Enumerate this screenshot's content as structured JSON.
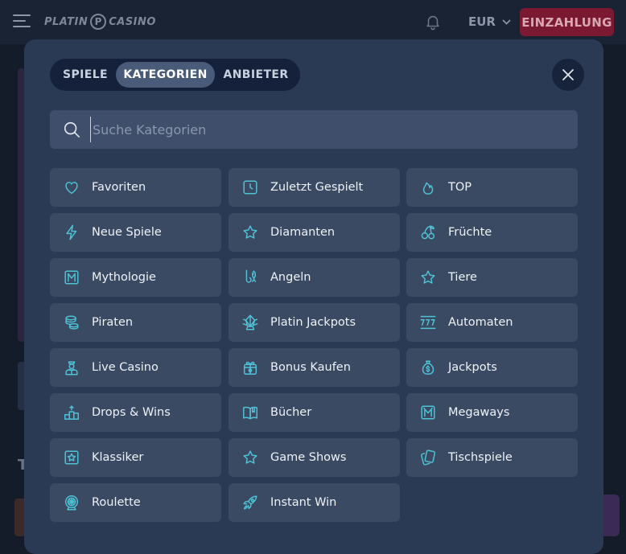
{
  "header": {
    "logo_left": "PLATIN",
    "logo_mark": "P",
    "logo_right": "CASINO",
    "currency": "EUR",
    "deposit_label": "EINZAHLUNG"
  },
  "background": {
    "partial_heading": "T"
  },
  "modal": {
    "tabs": [
      {
        "label": "SPIELE",
        "active": false
      },
      {
        "label": "KATEGORIEN",
        "active": true
      },
      {
        "label": "ANBIETER",
        "active": false
      }
    ],
    "search": {
      "placeholder": "Suche Kategorien",
      "value": ""
    },
    "categories": [
      {
        "label": "Favoriten",
        "icon": "heart-icon"
      },
      {
        "label": "Zuletzt Gespielt",
        "icon": "clock-icon"
      },
      {
        "label": "TOP",
        "icon": "flame-icon"
      },
      {
        "label": "Neue Spiele",
        "icon": "lightning-icon"
      },
      {
        "label": "Diamanten",
        "icon": "star-icon"
      },
      {
        "label": "Früchte",
        "icon": "cherries-icon"
      },
      {
        "label": "Mythologie",
        "icon": "mythology-icon"
      },
      {
        "label": "Angeln",
        "icon": "fishing-icon"
      },
      {
        "label": "Tiere",
        "icon": "star-icon"
      },
      {
        "label": "Piraten",
        "icon": "coins-icon"
      },
      {
        "label": "Platin Jackpots",
        "icon": "crystal-icon"
      },
      {
        "label": "Automaten",
        "icon": "slot-777-icon"
      },
      {
        "label": "Live Casino",
        "icon": "dealer-icon"
      },
      {
        "label": "Bonus Kaufen",
        "icon": "gift-icon"
      },
      {
        "label": "Jackpots",
        "icon": "money-bag-icon"
      },
      {
        "label": "Drops & Wins",
        "icon": "podium-icon"
      },
      {
        "label": "Bücher",
        "icon": "book-icon"
      },
      {
        "label": "Megaways",
        "icon": "megaways-icon"
      },
      {
        "label": "Klassiker",
        "icon": "star-square-icon"
      },
      {
        "label": "Game Shows",
        "icon": "star-icon"
      },
      {
        "label": "Tischspiele",
        "icon": "cards-icon"
      },
      {
        "label": "Roulette",
        "icon": "roulette-icon"
      },
      {
        "label": "Instant Win",
        "icon": "rocket-icon"
      }
    ]
  },
  "colors": {
    "accent": "#4fc3d6",
    "deposit": "#7a1931",
    "modal_bg": "#2b3a54",
    "tile_bg": "#3b4a63",
    "active_tab": "#4a5b7a"
  }
}
